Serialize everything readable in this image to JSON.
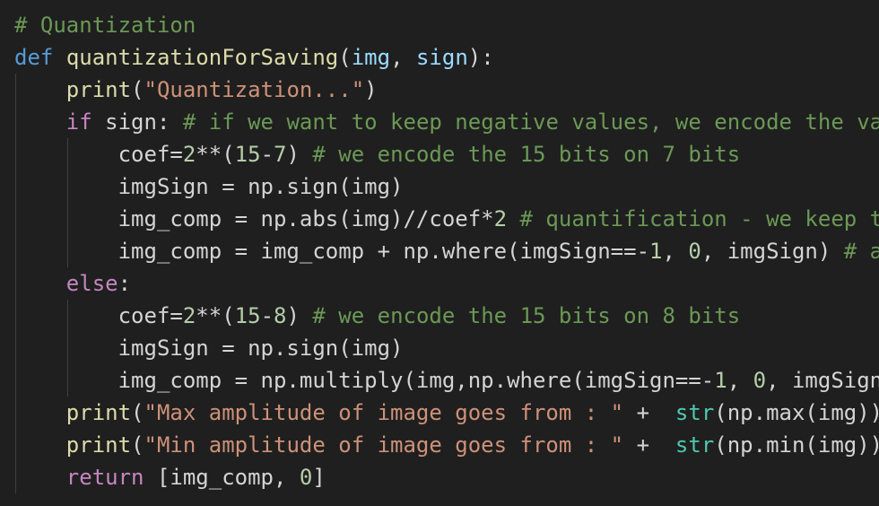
{
  "colors": {
    "background": "#1f1f1f",
    "plain": "#d4d4d4",
    "comment": "#6a9955",
    "keyword": "#c586c0",
    "decl": "#569cd6",
    "func": "#dcdcaa",
    "param": "#9cdcfe",
    "builtin": "#4ec9b0",
    "string": "#ce9178",
    "number": "#b5cea8",
    "indent_guide": "#404040"
  },
  "code": {
    "lines": [
      [
        [
          "comment",
          "# Quantization"
        ]
      ],
      [
        [
          "decl",
          "def"
        ],
        [
          "plain",
          " "
        ],
        [
          "func",
          "quantizationForSaving"
        ],
        [
          "plain",
          "("
        ],
        [
          "param",
          "img"
        ],
        [
          "plain",
          ", "
        ],
        [
          "param",
          "sign"
        ],
        [
          "plain",
          "):"
        ]
      ],
      [
        [
          "plain",
          "    "
        ],
        [
          "func",
          "print"
        ],
        [
          "plain",
          "("
        ],
        [
          "string",
          "\"Quantization...\""
        ],
        [
          "plain",
          ")"
        ]
      ],
      [
        [
          "plain",
          "    "
        ],
        [
          "keyword",
          "if"
        ],
        [
          "plain",
          " sign: "
        ],
        [
          "comment",
          "# if we want to keep negative values, we encode the va"
        ]
      ],
      [
        [
          "plain",
          "        coef="
        ],
        [
          "number",
          "2"
        ],
        [
          "plain",
          "**("
        ],
        [
          "number",
          "15"
        ],
        [
          "plain",
          "-"
        ],
        [
          "number",
          "7"
        ],
        [
          "plain",
          ") "
        ],
        [
          "comment",
          "# we encode the 15 bits on 7 bits"
        ]
      ],
      [
        [
          "plain",
          "        imgSign = np.sign(img)"
        ]
      ],
      [
        [
          "plain",
          "        img_comp = np.abs(img)//coef*"
        ],
        [
          "number",
          "2"
        ],
        [
          "plain",
          " "
        ],
        [
          "comment",
          "# quantification - we keep t"
        ]
      ],
      [
        [
          "plain",
          "        img_comp = img_comp + np.where(imgSign==-"
        ],
        [
          "number",
          "1"
        ],
        [
          "plain",
          ", "
        ],
        [
          "number",
          "0"
        ],
        [
          "plain",
          ", imgSign) "
        ],
        [
          "comment",
          "# a"
        ]
      ],
      [
        [
          "plain",
          "    "
        ],
        [
          "keyword",
          "else"
        ],
        [
          "plain",
          ":"
        ]
      ],
      [
        [
          "plain",
          "        coef="
        ],
        [
          "number",
          "2"
        ],
        [
          "plain",
          "**("
        ],
        [
          "number",
          "15"
        ],
        [
          "plain",
          "-"
        ],
        [
          "number",
          "8"
        ],
        [
          "plain",
          ") "
        ],
        [
          "comment",
          "# we encode the 15 bits on 8 bits"
        ]
      ],
      [
        [
          "plain",
          "        imgSign = np.sign(img)"
        ]
      ],
      [
        [
          "plain",
          "        img_comp = np.multiply(img,np.where(imgSign==-"
        ],
        [
          "number",
          "1"
        ],
        [
          "plain",
          ", "
        ],
        [
          "number",
          "0"
        ],
        [
          "plain",
          ", imgSign"
        ]
      ],
      [
        [
          "plain",
          "    "
        ],
        [
          "func",
          "print"
        ],
        [
          "plain",
          "("
        ],
        [
          "string",
          "\"Max amplitude of image goes from : \""
        ],
        [
          "plain",
          " +  "
        ],
        [
          "builtin",
          "str"
        ],
        [
          "plain",
          "(np.max(img))"
        ]
      ],
      [
        [
          "plain",
          "    "
        ],
        [
          "func",
          "print"
        ],
        [
          "plain",
          "("
        ],
        [
          "string",
          "\"Min amplitude of image goes from : \""
        ],
        [
          "plain",
          " +  "
        ],
        [
          "builtin",
          "str"
        ],
        [
          "plain",
          "(np.min(img))"
        ]
      ],
      [
        [
          "plain",
          "    "
        ],
        [
          "keyword",
          "return"
        ],
        [
          "plain",
          " [img_comp, "
        ],
        [
          "number",
          "0"
        ],
        [
          "plain",
          "]"
        ]
      ]
    ]
  }
}
